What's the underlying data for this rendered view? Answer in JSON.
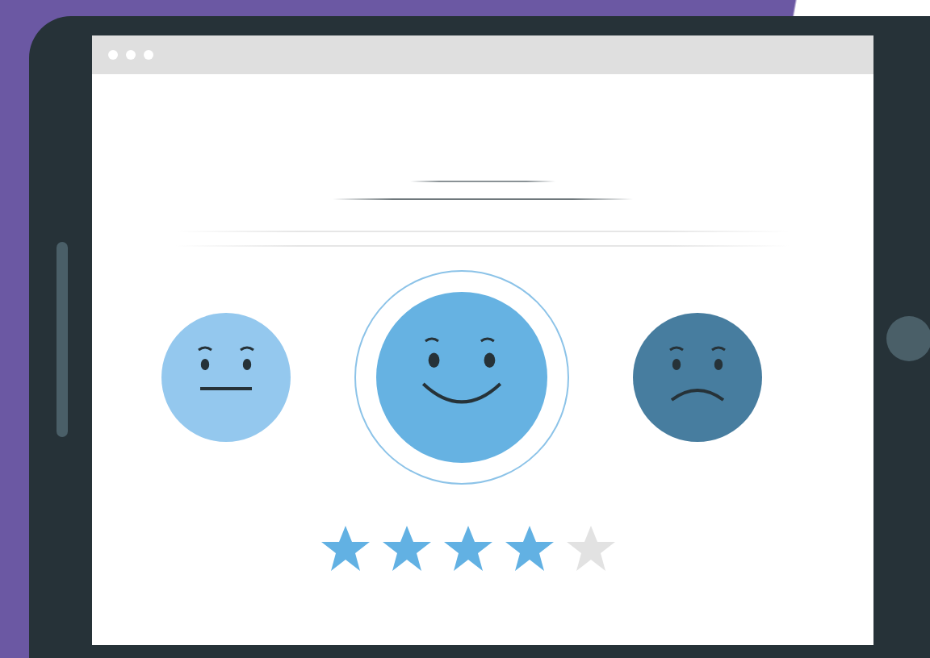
{
  "faces": [
    {
      "kind": "neutral",
      "selected": false,
      "color": "#94c8ee"
    },
    {
      "kind": "happy",
      "selected": true,
      "color": "#66b2e2"
    },
    {
      "kind": "sad",
      "selected": false,
      "color": "#477d9f"
    }
  ],
  "rating": {
    "stars": 4
  }
}
